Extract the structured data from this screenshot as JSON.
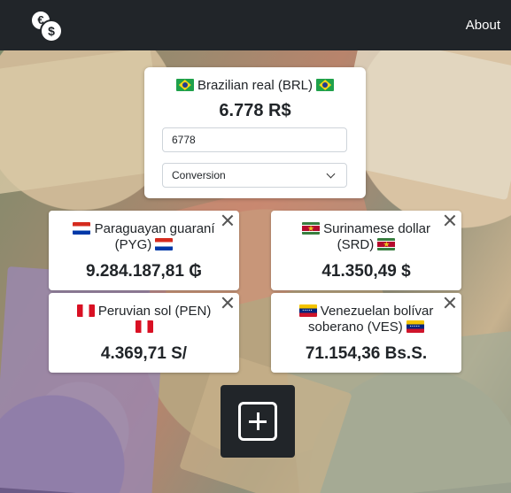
{
  "nav": {
    "about_label": "About"
  },
  "base": {
    "name": "Brazilian real (BRL)",
    "amount": "6.778 R$",
    "input_value": "6778",
    "select_value": "Conversion",
    "flag": "flag-brazil"
  },
  "cards": [
    {
      "name": "Paraguayan guaraní (PYG)",
      "value": "9.284.187,81 ₲",
      "flag": "flag-paraguay"
    },
    {
      "name": "Surinamese dollar (SRD)",
      "value": "41.350,49 $",
      "flag": "flag-suriname"
    },
    {
      "name": "Peruvian sol (PEN)",
      "value": "4.369,71 S/",
      "flag": "flag-peru"
    },
    {
      "name": "Venezuelan bolívar soberano (VES)",
      "value": "71.154,36 Bs.S.",
      "flag": "flag-venezuela"
    }
  ],
  "icons": {
    "brand": "currency-exchange-icon",
    "close": "close-icon",
    "add": "plus-square-icon",
    "dropdown": "chevron-down-icon"
  },
  "colors": {
    "navbar": "#212529",
    "card": "#ffffff",
    "text": "#212529"
  }
}
